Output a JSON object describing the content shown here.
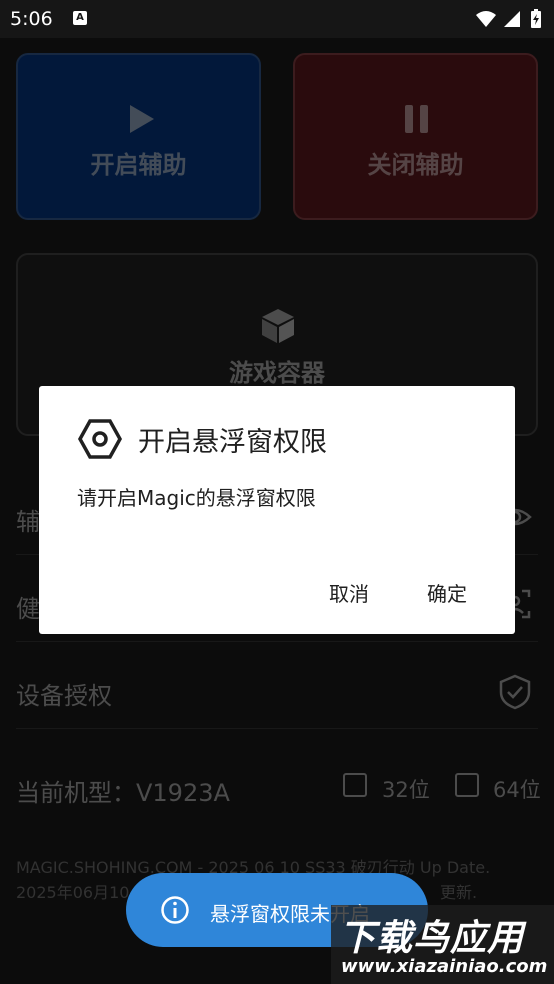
{
  "status_bar": {
    "time": "5:06",
    "badge": "A"
  },
  "buttons": {
    "start_label": "开启辅助",
    "stop_label": "关闭辅助",
    "container_label": "游戏容器"
  },
  "rows": [
    {
      "label": "辅",
      "icon": "eye-icon"
    },
    {
      "label": "健",
      "icon": "face-scan-icon"
    },
    {
      "label": "设备授权",
      "icon": "shield-check-icon"
    }
  ],
  "model": {
    "label": "当前机型：V1923A",
    "options": [
      {
        "label": "32位",
        "checked": false
      },
      {
        "label": "64位",
        "checked": false
      }
    ]
  },
  "footer": {
    "line1": "MAGIC.SHOHING.COM - 2025 06 10 SS33 破刃行动 Up Date.",
    "line2": "2025年06月10",
    "line2_tail": "更新."
  },
  "dialog": {
    "title": "开启悬浮窗权限",
    "message": "请开启Magic的悬浮窗权限",
    "cancel": "取消",
    "confirm": "确定"
  },
  "toast": {
    "text": "悬浮窗权限未开启"
  },
  "watermark": {
    "title": "下载鸟应用",
    "url": "www.xiazainiao.com"
  },
  "colors": {
    "start_bg": "#052d6b",
    "stop_bg": "#4e1519",
    "toast_bg": "#2f86d9",
    "background": "#161616"
  }
}
